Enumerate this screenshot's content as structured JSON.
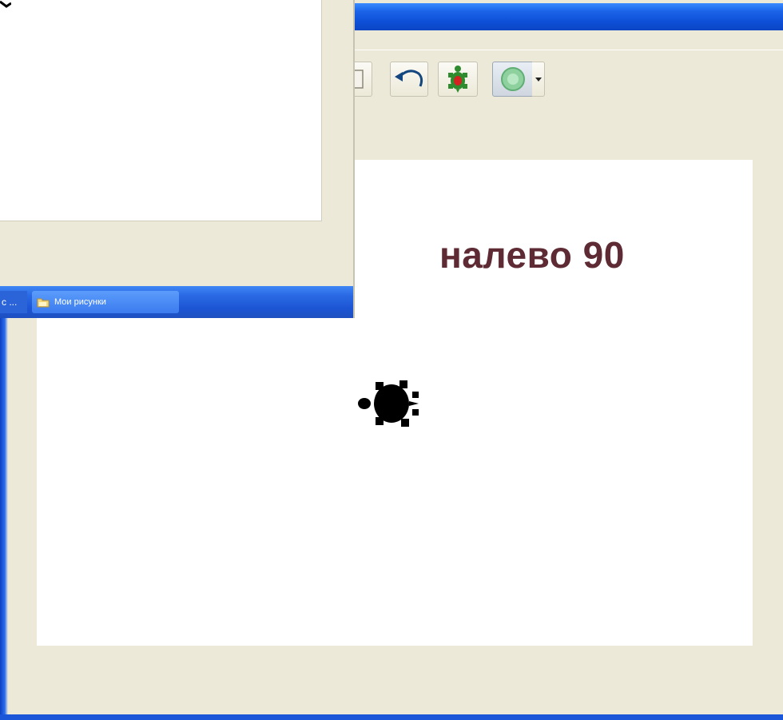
{
  "command": {
    "text": "налево 90"
  },
  "taskbar": {
    "left_item_label": "с ...",
    "item_label": "Мои рисунки"
  },
  "toolbar": {
    "icons": [
      "partial-button-icon",
      "undo-icon",
      "turtle-icon",
      "color-circle-icon",
      "dropdown-arrow-icon"
    ]
  },
  "colors": {
    "titlebar_blue": "#1b63e8",
    "window_bg": "#ece9d8",
    "command_text": "#5e2a33",
    "turtle": "#000000"
  }
}
